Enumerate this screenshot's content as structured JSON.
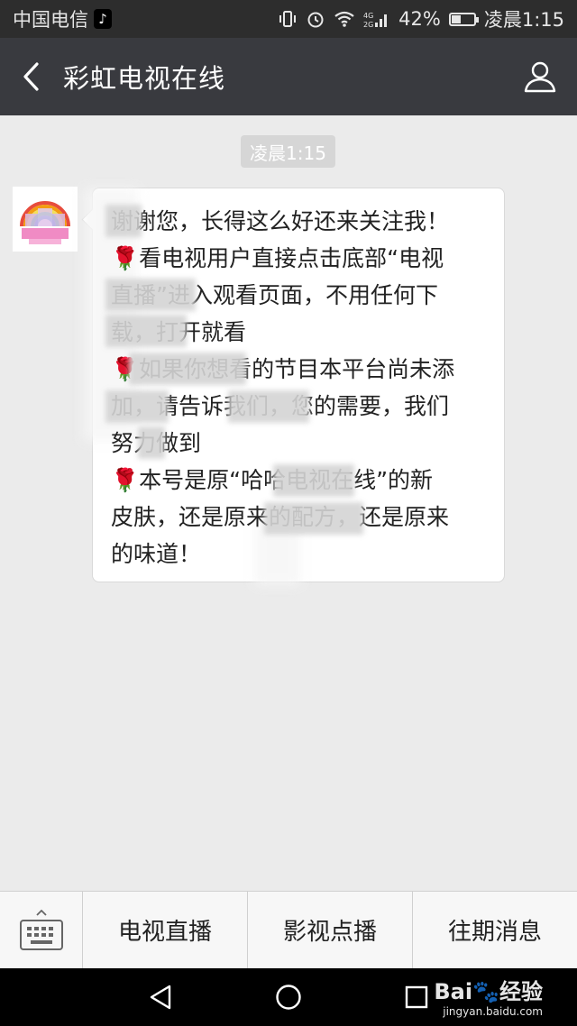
{
  "status_bar": {
    "carrier": "中国电信",
    "battery": "42%",
    "time": "凌晨1:15",
    "battery_level": 0.42,
    "icons": [
      "tiktok-icon",
      "vibrate-icon",
      "alarm-icon",
      "wifi-icon",
      "signal-icon",
      "battery-icon"
    ]
  },
  "header": {
    "title": "彩虹电视在线",
    "back_icon": "chevron-left-icon",
    "profile_icon": "person-icon"
  },
  "chat": {
    "timestamp": "凌晨1:15",
    "message_lines": [
      "谢谢您，长得这么好还来关注我！",
      "🌹看电视用户直接点击底部“电视",
      "直播”进入观看页面，不用任何下",
      "载，打开就看",
      "🌹如果你想看的节目本平台尚未添",
      "加，请告诉我们，您的需要，我们",
      "努力做到",
      "🌹本号是原“哈哈电视在线”的新",
      "皮肤，还是原来的配方，还是原来",
      "的味道！"
    ]
  },
  "menu": {
    "keyboard_icon": "keyboard-icon",
    "items": [
      "电视直播",
      "影视点播",
      "往期消息"
    ]
  },
  "nav": {
    "icons": [
      "back-triangle-icon",
      "home-circle-icon",
      "recents-square-icon"
    ]
  },
  "watermark": {
    "main": "Bai🐾经验",
    "sub": "jingyan.baidu.com"
  },
  "colors": {
    "status_bg": "#2d2d2d",
    "header_bg": "#393a3f",
    "chat_bg": "#ebebeb",
    "bubble_bg": "#ffffff",
    "menu_bg": "#f7f7f7"
  }
}
